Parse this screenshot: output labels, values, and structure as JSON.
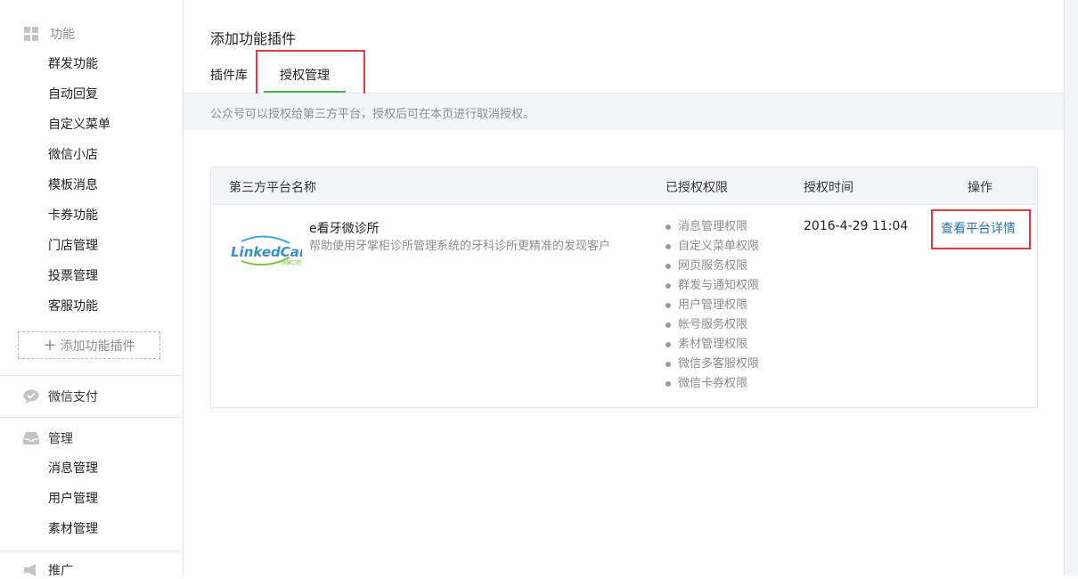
{
  "sidebar": {
    "function_section": {
      "label": "功能",
      "icon": "grid-icon"
    },
    "function_items": [
      "群发功能",
      "自动回复",
      "自定义菜单",
      "微信小店",
      "模板消息",
      "卡券功能",
      "门店管理",
      "投票管理",
      "客服功能"
    ],
    "add_plugin_label": "添加功能插件",
    "pay_section": {
      "label": "微信支付",
      "icon": "wechat-pay-icon"
    },
    "manage_section": {
      "label": "管理",
      "icon": "inbox-icon"
    },
    "manage_items": [
      "消息管理",
      "用户管理",
      "素材管理"
    ],
    "promo_section": {
      "label": "推广",
      "icon": "megaphone-icon"
    }
  },
  "main": {
    "title": "添加功能插件",
    "tabs": [
      {
        "label": "插件库",
        "active": false
      },
      {
        "label": "授权管理",
        "active": true
      }
    ],
    "notice": "公众号可以授权给第三方平台，授权后可在本页进行取消授权。"
  },
  "table": {
    "headers": {
      "platform_name": "第三方平台名称",
      "permissions": "已授权权限",
      "auth_time": "授权时间",
      "action": "操作"
    },
    "rows": [
      {
        "logo_text": "LinkedCare",
        "logo_subtext": "领健口腔",
        "name": "e看牙微诊所",
        "description": "帮助使用牙掌柜诊所管理系统的牙科诊所更精准的发现客户",
        "permissions": [
          "消息管理权限",
          "自定义菜单权限",
          "网页服务权限",
          "群发与通知权限",
          "用户管理权限",
          "帐号服务权限",
          "素材管理权限",
          "微信多客服权限",
          "微信卡券权限"
        ],
        "auth_time": "2016-4-29 11:04",
        "action_label": "查看平台详情"
      }
    ]
  },
  "colors": {
    "accent_green": "#44b549",
    "link_blue": "#2b6fb3",
    "highlight_red": "#e0393e",
    "notice_bg": "#f4f5f9"
  }
}
